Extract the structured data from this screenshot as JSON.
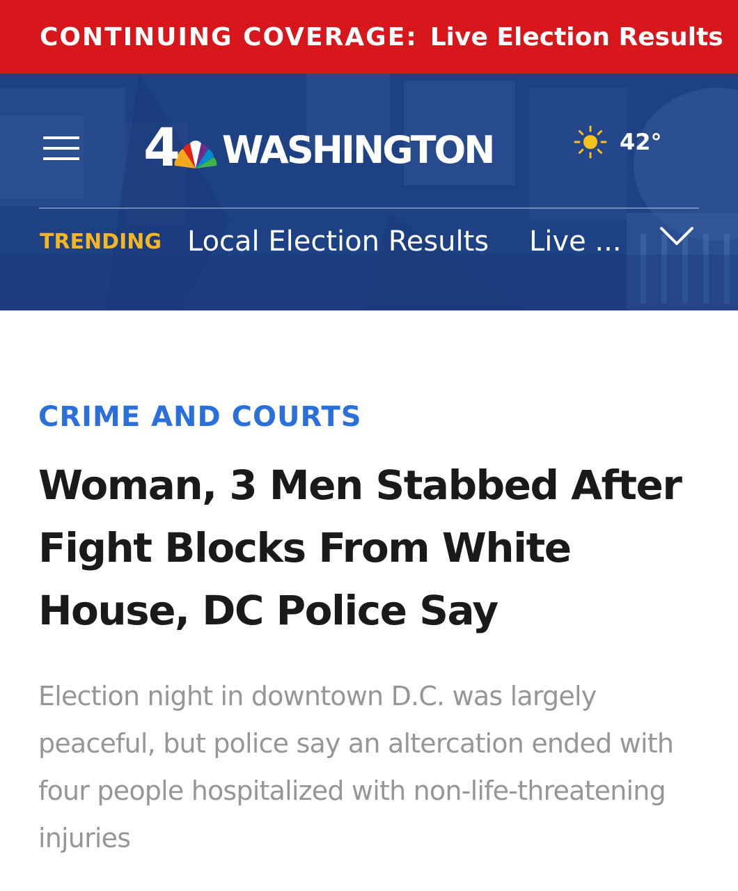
{
  "alert": {
    "prefix": "CONTINUING COVERAGE",
    "separator": ":",
    "link_text": "Live Election Results",
    "background_color": "#d7171b"
  },
  "header": {
    "logo": {
      "channel_number": "4",
      "station_name": "WASHINGTON",
      "peacock_icon": "nbc-peacock-icon"
    },
    "menu_icon": "hamburger-menu-icon",
    "weather": {
      "icon": "sun-icon",
      "temperature": "42°"
    },
    "trending": {
      "label": "TRENDING",
      "items": [
        "Local Election Results",
        "Live ..."
      ],
      "expand_icon": "chevron-down-icon"
    },
    "background_color": "#1e4183",
    "trending_color": "#f4b623"
  },
  "article": {
    "category": "CRIME AND COURTS",
    "headline": "Woman, 3 Men Stabbed After Fight Blocks From White House, DC Police Say",
    "summary": "Election night in downtown D.C. was largely peaceful, but police say an altercation ended with four people hospitalized with non-life-threatening injuries",
    "category_color": "#2a6fdc"
  }
}
